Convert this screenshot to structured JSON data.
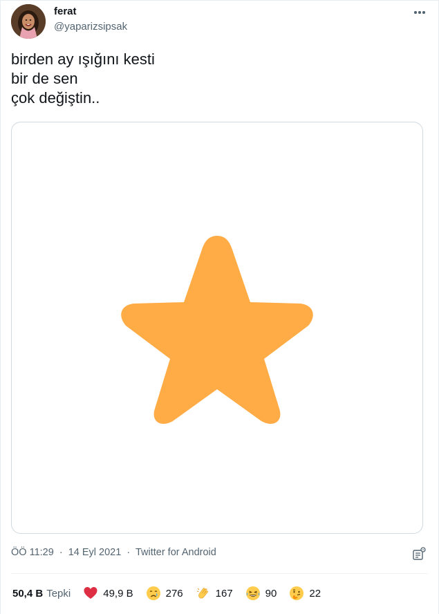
{
  "author": {
    "name": "ferat",
    "handle": "@yaparizsipsak"
  },
  "tweet": {
    "lines": [
      "birden ay ışığını kesti",
      "bir de sen",
      "çok değiştin.."
    ],
    "media_icon": "star-icon",
    "star_color": "#FFAC47"
  },
  "meta": {
    "time": "ÖÖ 11:29",
    "date": "14 Eyl 2021",
    "separator": "·",
    "source": "Twitter for Android"
  },
  "reactions": {
    "total": "50,4 B",
    "total_label": "Tepki",
    "items": [
      {
        "icon": "heart-emoji",
        "count": "49,9 B"
      },
      {
        "icon": "crying-face-emoji",
        "count": "276"
      },
      {
        "icon": "clapping-hands-emoji",
        "count": "167"
      },
      {
        "icon": "laughing-face-emoji",
        "count": "90"
      },
      {
        "icon": "thinking-face-emoji",
        "count": "22"
      }
    ]
  }
}
